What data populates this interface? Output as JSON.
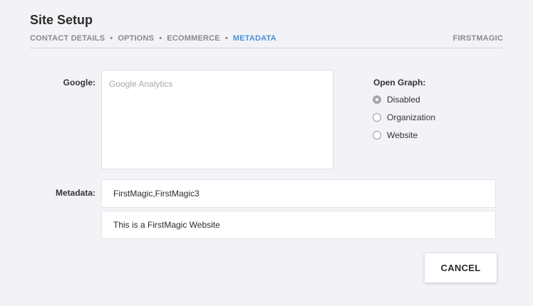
{
  "header": {
    "title": "Site Setup",
    "brand": "FIRSTMAGIC"
  },
  "breadcrumb": {
    "items": [
      {
        "label": "CONTACT DETAILS",
        "active": false
      },
      {
        "label": "OPTIONS",
        "active": false
      },
      {
        "label": "ECOMMERCE",
        "active": false
      },
      {
        "label": "METADATA",
        "active": true
      }
    ],
    "separator": "•"
  },
  "form": {
    "google_label": "Google:",
    "google_placeholder": "Google Analytics",
    "google_value": "",
    "open_graph": {
      "title": "Open Graph:",
      "options": [
        "Disabled",
        "Organization",
        "Website"
      ],
      "selected": "Disabled"
    },
    "metadata_label": "Metadata:",
    "keywords_value": "FirstMagic,FirstMagic3",
    "description_value": "This is a FirstMagic Website"
  },
  "actions": {
    "cancel_label": "CANCEL"
  },
  "colors": {
    "accent": "#4a90d9",
    "background": "#f3f3f7"
  }
}
